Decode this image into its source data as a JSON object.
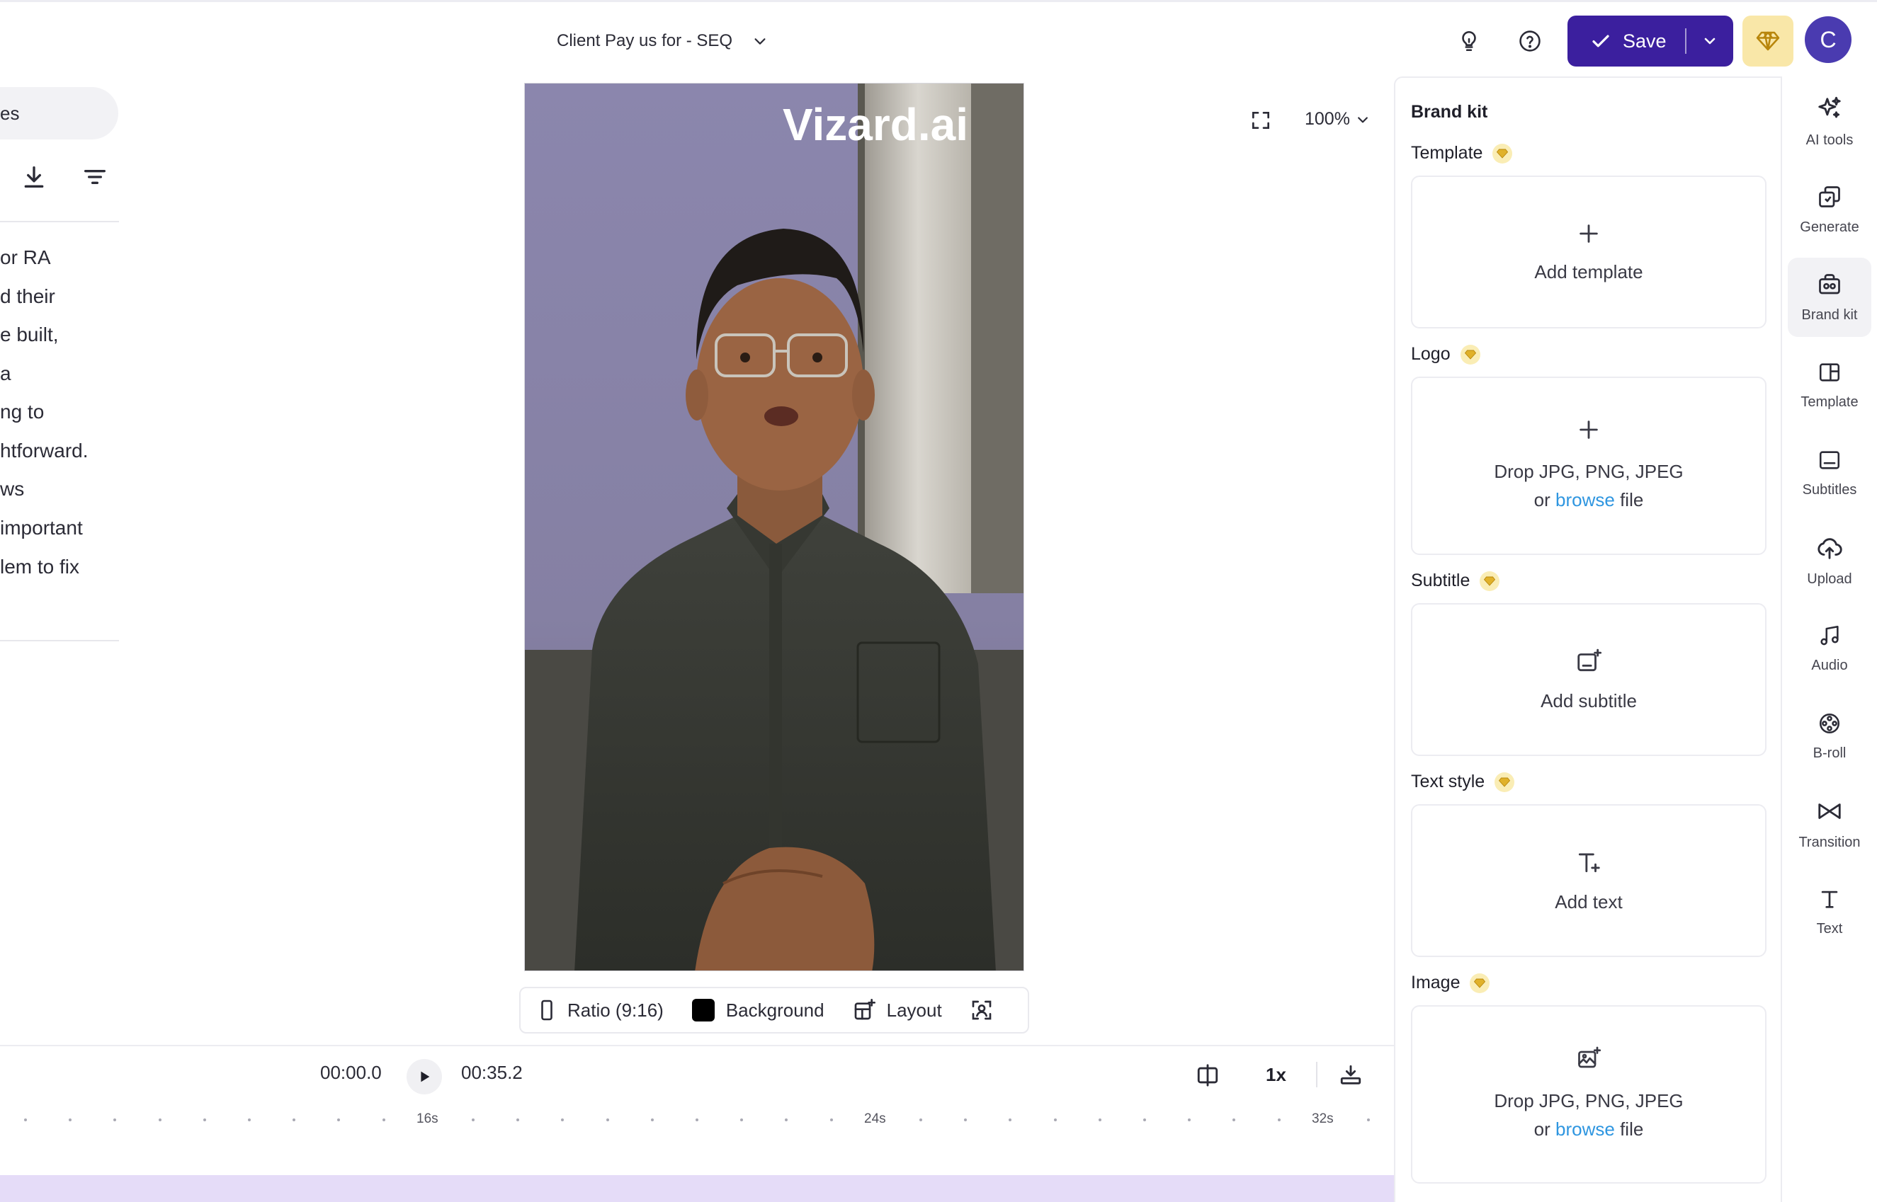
{
  "header": {
    "project_title": "Client Pay us for - SEQ",
    "save_label": "Save",
    "avatar_initial": "C"
  },
  "left_panel": {
    "search_text": "es",
    "transcript_lines": [
      "or RA",
      "d their",
      "e built,",
      "a",
      "ng to",
      "htforward.",
      "ws",
      "important",
      "lem to fix"
    ]
  },
  "preview": {
    "watermark": "Vizard.ai",
    "zoom_label": "100%"
  },
  "video_toolbar": {
    "ratio_label": "Ratio (9:16)",
    "background_label": "Background",
    "layout_label": "Layout"
  },
  "timeline": {
    "current_time": "00:00.0",
    "total_time": "00:35.2",
    "speed": "1x",
    "tick_labels": [
      "16s",
      "24s",
      "32s"
    ]
  },
  "brand_kit": {
    "title": "Brand kit",
    "sections": {
      "template": {
        "label": "Template",
        "action": "Add template"
      },
      "logo": {
        "label": "Logo",
        "drop_text": "Drop JPG, PNG, JPEG",
        "or_text": "or",
        "browse_text": "browse",
        "file_text": "file"
      },
      "subtitle": {
        "label": "Subtitle",
        "action": "Add subtitle"
      },
      "text_style": {
        "label": "Text style",
        "action": "Add text"
      },
      "image": {
        "label": "Image",
        "drop_text": "Drop JPG, PNG, JPEG",
        "or_text": "or",
        "browse_text": "browse",
        "file_text": "file"
      }
    }
  },
  "rail": {
    "items": [
      {
        "label": "AI tools",
        "icon": "sparkle-icon"
      },
      {
        "label": "Generate",
        "icon": "generate-icon"
      },
      {
        "label": "Brand kit",
        "icon": "brand-kit-icon",
        "active": true
      },
      {
        "label": "Template",
        "icon": "template-icon"
      },
      {
        "label": "Subtitles",
        "icon": "subtitles-icon"
      },
      {
        "label": "Upload",
        "icon": "upload-icon"
      },
      {
        "label": "Audio",
        "icon": "music-icon"
      },
      {
        "label": "B-roll",
        "icon": "film-reel-icon"
      },
      {
        "label": "Transition",
        "icon": "transition-icon"
      },
      {
        "label": "Text",
        "icon": "text-icon"
      }
    ]
  },
  "colors": {
    "primary": "#3b1f9e",
    "premium": "#f9e7a8",
    "link": "#2f96e0",
    "track": "#e5dcf8"
  }
}
